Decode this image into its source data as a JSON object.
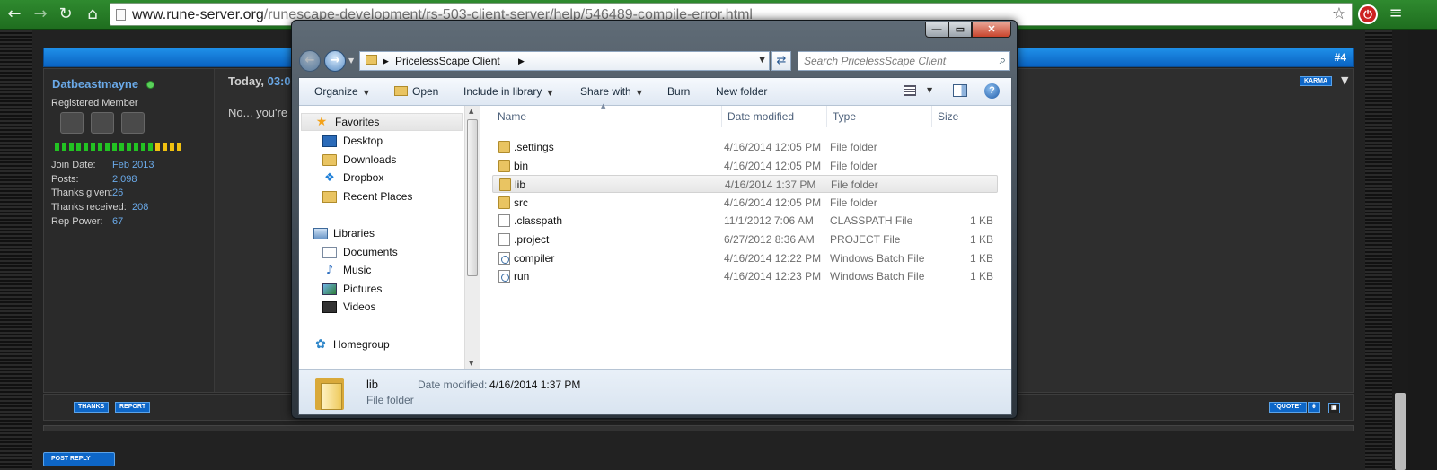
{
  "browser": {
    "url_host": "www.rune-server.org",
    "url_path": "/runescape-development/rs-503-client-server/help/546489-compile-error.html"
  },
  "forum": {
    "post_number": "#4",
    "username": "Datbeastmayne",
    "user_title": "Registered Member",
    "stats": [
      {
        "label": "Join Date:",
        "value": "Feb 2013"
      },
      {
        "label": "Posts:",
        "value": "2,098"
      },
      {
        "label": "Thanks given:",
        "value": "26"
      },
      {
        "label": "Thanks received:",
        "value": "208"
      },
      {
        "label": "Rep Power:",
        "value": "67"
      }
    ],
    "post_time_day": "Today,",
    "post_time": "03:0",
    "post_text": "No... you're",
    "karma_label": "KARMA",
    "thanks_label": "THANKS",
    "report_label": "REPORT",
    "quote_label": "\"QUOTE\"",
    "post_reply_label": "POST REPLY",
    "rep_colors": [
      "#22c322",
      "#22c322",
      "#22c322",
      "#22c322",
      "#22c322",
      "#22c322",
      "#22c322",
      "#22c322",
      "#22c322",
      "#22c322",
      "#22c322",
      "#22c322",
      "#22c322",
      "#22c322",
      "#f0c010",
      "#f0c010",
      "#f0c010",
      "#f0c010"
    ]
  },
  "explorer": {
    "breadcrumb": "PricelessScape Client",
    "search_placeholder": "Search PricelessScape Client",
    "toolbar": {
      "organize": "Organize",
      "open": "Open",
      "include_in_library": "Include in library",
      "share_with": "Share with",
      "burn": "Burn",
      "new_folder": "New folder"
    },
    "nav": {
      "favorites": "Favorites",
      "favorites_items": [
        "Desktop",
        "Downloads",
        "Dropbox",
        "Recent Places"
      ],
      "libraries": "Libraries",
      "libraries_items": [
        "Documents",
        "Music",
        "Pictures",
        "Videos"
      ],
      "homegroup": "Homegroup"
    },
    "columns": [
      "Name",
      "Date modified",
      "Type",
      "Size"
    ],
    "files": [
      {
        "name": ".settings",
        "date": "4/16/2014 12:05 PM",
        "type": "File folder",
        "size": "",
        "icon": "folder-icon"
      },
      {
        "name": "bin",
        "date": "4/16/2014 12:05 PM",
        "type": "File folder",
        "size": "",
        "icon": "folder-icon"
      },
      {
        "name": "lib",
        "date": "4/16/2014 1:37 PM",
        "type": "File folder",
        "size": "",
        "icon": "folder-icon"
      },
      {
        "name": "src",
        "date": "4/16/2014 12:05 PM",
        "type": "File folder",
        "size": "",
        "icon": "folder-icon"
      },
      {
        "name": ".classpath",
        "date": "11/1/2012 7:06 AM",
        "type": "CLASSPATH File",
        "size": "1 KB",
        "icon": "file-icon"
      },
      {
        "name": ".project",
        "date": "6/27/2012 8:36 AM",
        "type": "PROJECT File",
        "size": "1 KB",
        "icon": "file-icon"
      },
      {
        "name": "compiler",
        "date": "4/16/2014 12:22 PM",
        "type": "Windows Batch File",
        "size": "1 KB",
        "icon": "batch-file-icon"
      },
      {
        "name": "run",
        "date": "4/16/2014 12:23 PM",
        "type": "Windows Batch File",
        "size": "1 KB",
        "icon": "batch-file-icon"
      }
    ],
    "selected_file": "lib",
    "details": {
      "name": "lib",
      "type": "File folder",
      "date_label": "Date modified:",
      "date_value": "4/16/2014 1:37 PM"
    }
  }
}
